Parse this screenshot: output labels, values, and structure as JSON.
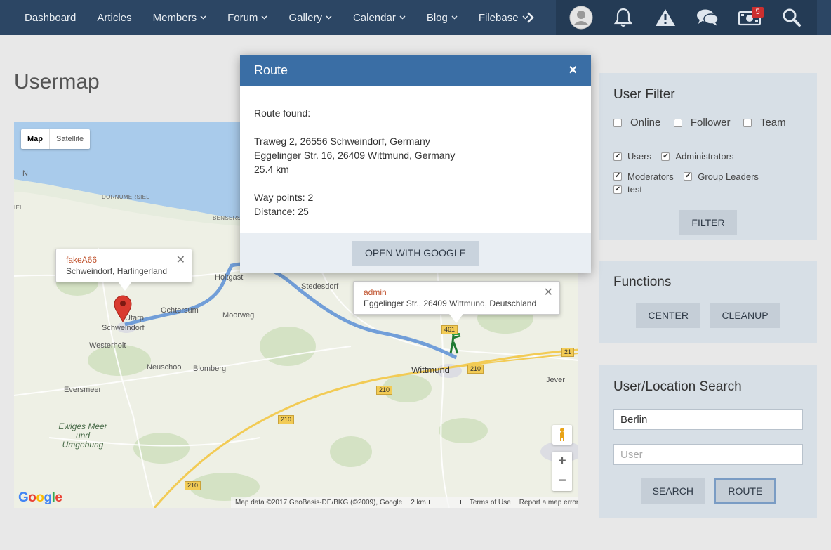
{
  "nav": {
    "items": [
      {
        "label": "Dashboard",
        "has_dropdown": false
      },
      {
        "label": "Articles",
        "has_dropdown": false
      },
      {
        "label": "Members",
        "has_dropdown": true
      },
      {
        "label": "Forum",
        "has_dropdown": true
      },
      {
        "label": "Gallery",
        "has_dropdown": true
      },
      {
        "label": "Calendar",
        "has_dropdown": true
      },
      {
        "label": "Blog",
        "has_dropdown": true
      },
      {
        "label": "Filebase",
        "has_dropdown": true
      }
    ],
    "more_icon": "chevron-right-icon",
    "user_icons": [
      "avatar",
      "bell-icon",
      "warning-icon",
      "chat-icon",
      "money-icon",
      "search-icon"
    ],
    "notification_badge": "5",
    "colors": {
      "bar": "#2c4664",
      "user_bar": "#243b55",
      "accent": "#3a6ea5"
    }
  },
  "page": {
    "title": "Usermap"
  },
  "map": {
    "type_controls": [
      "Map",
      "Satellite"
    ],
    "active_type": "Map",
    "labels": {
      "n": "N",
      "iel": "IEL",
      "dornumersiel": "DORNUMERSIEL",
      "bensersiel": "BENSERS",
      "holtgast": "Holtgast",
      "utarp": "Utarp",
      "schweindorf": "Schweindorf",
      "ochtersum": "Ochtersum",
      "moorweg": "Moorweg",
      "stedesdorf": "Stedesdorf",
      "westerholt": "Westerholt",
      "neuschoo": "Neuschoo",
      "blomberg": "Blomberg",
      "eversmeer": "Eversmeer",
      "wittmund": "Wittmund",
      "jever": "Jever",
      "ewiges_meer": "Ewiges Meer und Umgebung"
    },
    "road_shields": {
      "r461": "461",
      "r210a": "210",
      "r210b": "210",
      "r210c": "210",
      "r210d": "210",
      "r21": "21"
    },
    "markers": [
      {
        "name": "fakeA66",
        "address": "Schweindorf, Harlingerland"
      },
      {
        "name": "admin",
        "address": "Eggelinger Str., 26409 Wittmund, Deutschland"
      }
    ],
    "zoom": {
      "in": "+",
      "out": "−"
    },
    "logo": "Google",
    "attribution": {
      "data": "Map data ©2017 GeoBasis-DE/BKG (©2009), Google",
      "scale": "2 km",
      "terms": "Terms of Use",
      "report": "Report a map error"
    },
    "colors": {
      "water": "#a9cbeb",
      "route": "#5b8fd6",
      "land": "#eef0e5"
    }
  },
  "modal": {
    "title": "Route",
    "close": "×",
    "found": "Route found:",
    "from": "Traweg 2, 26556 Schweindorf, Germany",
    "to": "Eggelinger Str. 16, 26409 Wittmund, Germany",
    "length": "25.4 km",
    "waypoints": "Way points: 2",
    "distance": "Distance: 25",
    "open_button": "OPEN WITH GOOGLE"
  },
  "user_filter": {
    "title": "User Filter",
    "row1": [
      {
        "label": "Online",
        "checked": false
      },
      {
        "label": "Follower",
        "checked": false
      },
      {
        "label": "Team",
        "checked": false
      }
    ],
    "groups": [
      {
        "label": "Users",
        "checked": true
      },
      {
        "label": "Administrators",
        "checked": true
      },
      {
        "label": "Moderators",
        "checked": true
      },
      {
        "label": "Group Leaders",
        "checked": true
      },
      {
        "label": "test",
        "checked": true
      }
    ],
    "button": "FILTER"
  },
  "functions": {
    "title": "Functions",
    "center": "CENTER",
    "cleanup": "CLEANUP"
  },
  "search": {
    "title": "User/Location Search",
    "location_value": "Berlin",
    "user_placeholder": "User",
    "search_button": "SEARCH",
    "route_button": "ROUTE"
  }
}
